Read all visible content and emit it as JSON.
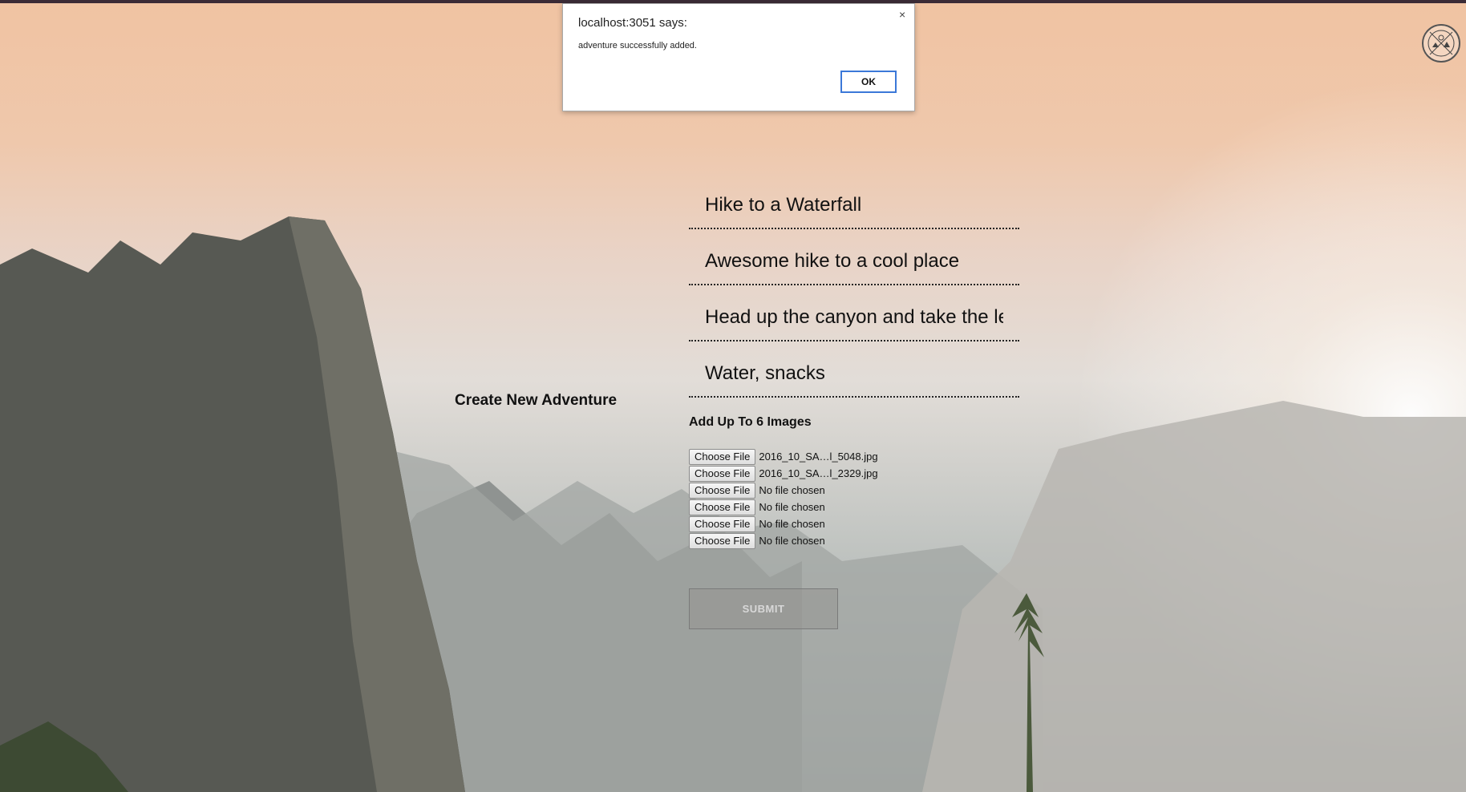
{
  "dialog": {
    "title": "localhost:3051 says:",
    "message": "adventure successfully added.",
    "ok_label": "OK",
    "close_glyph": "×"
  },
  "logo": {
    "icon": "compass-mountain-badge-icon"
  },
  "page_title": "Create New Adventure",
  "form": {
    "fields": [
      {
        "value": "Hike to a Waterfall"
      },
      {
        "value": "Awesome hike to a cool place"
      },
      {
        "value": "Head up the canyon and take the left fork at the trail junction"
      },
      {
        "value": "Water, snacks"
      }
    ],
    "images_label": "Add Up To 6 Images",
    "file_inputs": [
      {
        "button": "Choose File",
        "filename": "2016_10_SA…l_5048.jpg"
      },
      {
        "button": "Choose File",
        "filename": "2016_10_SA…l_2329.jpg"
      },
      {
        "button": "Choose File",
        "filename": "No file chosen"
      },
      {
        "button": "Choose File",
        "filename": "No file chosen"
      },
      {
        "button": "Choose File",
        "filename": "No file chosen"
      },
      {
        "button": "Choose File",
        "filename": "No file chosen"
      }
    ],
    "submit_label": "SUBMIT"
  }
}
